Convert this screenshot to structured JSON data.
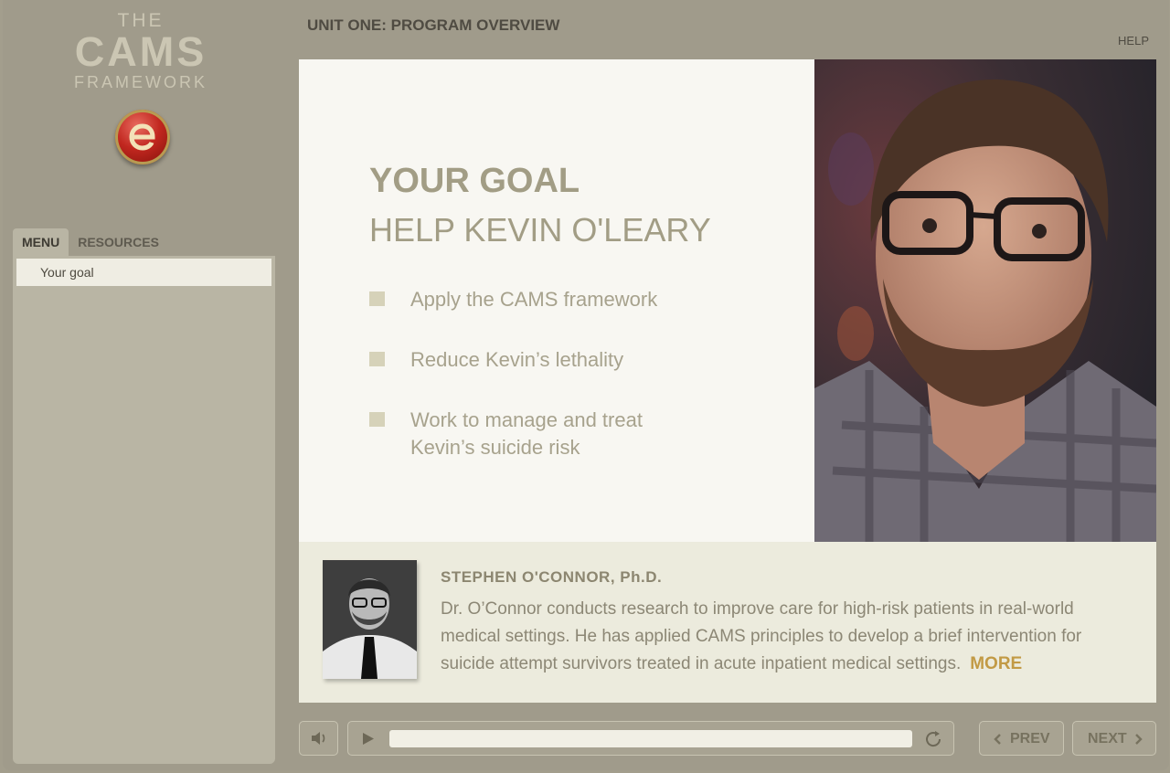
{
  "logo": {
    "line1": "THE",
    "line2": "CAMS",
    "line3": "FRAMEWORK"
  },
  "header": {
    "unit_title": "UNIT ONE: PROGRAM OVERVIEW",
    "help_label": "HELP"
  },
  "sidebar": {
    "tabs": [
      {
        "label": "MENU",
        "active": true
      },
      {
        "label": "RESOURCES",
        "active": false
      }
    ],
    "items": [
      {
        "label": "Your goal",
        "selected": true
      }
    ]
  },
  "slide": {
    "title": "YOUR GOAL",
    "subtitle": "HELP KEVIN O'LEARY",
    "bullets": [
      "Apply the CAMS framework",
      "Reduce Kevin’s lethality",
      "Work to manage and treat Kevin’s suicide risk"
    ]
  },
  "bio": {
    "name": "STEPHEN O'CONNOR, Ph.D.",
    "text": "Dr. O’Connor conducts research to improve care for high-risk patients in real-world medical settings. He has applied CAMS principles to develop a brief intervention for suicide attempt survivors treated in acute inpatient medical settings.",
    "more_label": "MORE"
  },
  "controls": {
    "mute_icon": "speaker-icon",
    "play_icon": "play-icon",
    "replay_icon": "replay-icon",
    "progress": 0,
    "prev_label": "PREV",
    "next_label": "NEXT"
  },
  "colors": {
    "accent": "#c29a45",
    "background": "#a09b8b",
    "slide_text": "#a29d85"
  }
}
